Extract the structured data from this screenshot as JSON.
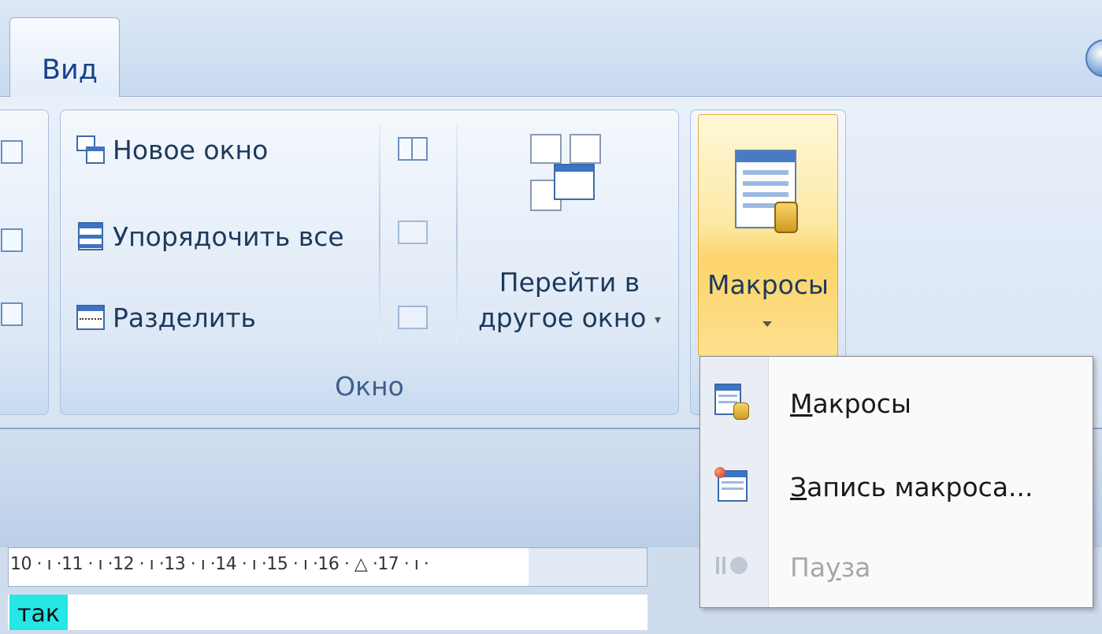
{
  "ribbon": {
    "active_tab": "Вид",
    "window_group": {
      "label": "Окно",
      "new_window": "Новое окно",
      "arrange_all": "Упорядочить все",
      "split": "Разделить",
      "switch_line1": "Перейти в",
      "switch_line2": "другое окно"
    },
    "macros_button": "Макросы"
  },
  "ruler": {
    "text": "10 · ı ·11 · ı ·12 · ı ·13 · ı ·14 · ı ·15 · ı ·16 · △ ·17 · ı ·"
  },
  "document": {
    "visible_text": "так"
  },
  "macros_menu": {
    "items": [
      {
        "prefix": "",
        "accel": "М",
        "rest": "акросы",
        "enabled": true,
        "icon": "macros-icon"
      },
      {
        "prefix": "",
        "accel": "З",
        "rest": "апись макроса...",
        "enabled": true,
        "icon": "record-macro-icon"
      },
      {
        "prefix": "Па",
        "accel": "у",
        "rest": "за",
        "enabled": false,
        "icon": "pause-icon"
      }
    ]
  }
}
